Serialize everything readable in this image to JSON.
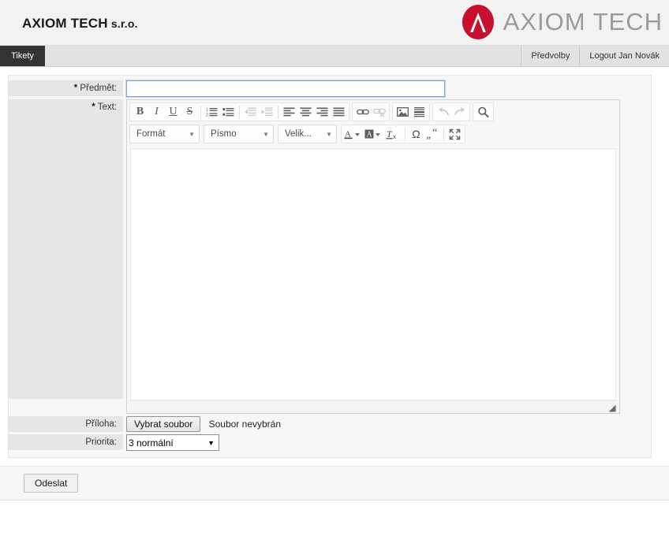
{
  "header": {
    "company_name": "AXIOM TECH",
    "company_suffix": " s.r.o.",
    "brand_text": "AXIOM TECH",
    "logo_color": "#c8102e",
    "logo_icon": "axiom-a-mark"
  },
  "navbar": {
    "tab_label": "Tikety",
    "links": [
      {
        "label": "Předvolby",
        "name": "preferences-link"
      },
      {
        "label": "Logout Jan Novák",
        "name": "logout-link"
      }
    ]
  },
  "form": {
    "subject": {
      "label": "Předmět:",
      "required_mark": "*",
      "value": "",
      "placeholder": ""
    },
    "text": {
      "label": "Text:",
      "required_mark": "*",
      "content": ""
    },
    "attachment": {
      "label": "Příloha:",
      "button_label": "Vybrat soubor",
      "file_status": "Soubor nevybrán"
    },
    "priority": {
      "label": "Priorita:",
      "selected": "3 normální",
      "options": [
        "3 normální"
      ]
    },
    "submit": {
      "label": "Odeslat"
    }
  },
  "editor_toolbar": {
    "row1": [
      {
        "name": "bold-icon",
        "glyph": "B",
        "state": "active"
      },
      {
        "name": "italic-icon",
        "glyph": "I",
        "state": "active"
      },
      {
        "name": "underline-icon",
        "glyph": "U",
        "state": "active"
      },
      {
        "name": "strikethrough-icon",
        "glyph": "S",
        "state": "active"
      },
      {
        "name": "numbered-list-icon",
        "glyph": "",
        "state": "active"
      },
      {
        "name": "bulleted-list-icon",
        "glyph": "",
        "state": "active"
      },
      {
        "name": "outdent-icon",
        "glyph": "",
        "state": "disabled"
      },
      {
        "name": "indent-icon",
        "glyph": "",
        "state": "disabled"
      },
      {
        "name": "align-left-icon",
        "glyph": "",
        "state": "active"
      },
      {
        "name": "align-center-icon",
        "glyph": "",
        "state": "active"
      },
      {
        "name": "align-right-icon",
        "glyph": "",
        "state": "active"
      },
      {
        "name": "align-justify-icon",
        "glyph": "",
        "state": "active"
      },
      {
        "name": "link-icon",
        "glyph": "",
        "state": "active"
      },
      {
        "name": "unlink-icon",
        "glyph": "",
        "state": "disabled"
      },
      {
        "name": "image-icon",
        "glyph": "",
        "state": "active"
      },
      {
        "name": "horizontal-rule-icon",
        "glyph": "",
        "state": "active"
      },
      {
        "name": "undo-icon",
        "glyph": "",
        "state": "disabled"
      },
      {
        "name": "redo-icon",
        "glyph": "",
        "state": "disabled"
      },
      {
        "name": "find-icon",
        "glyph": "",
        "state": "active"
      }
    ],
    "combos": [
      {
        "name": "format-combo",
        "label": "Formát"
      },
      {
        "name": "font-combo",
        "label": "Písmo"
      },
      {
        "name": "fontsize-combo",
        "label": "Velik..."
      }
    ],
    "row2": [
      {
        "name": "text-color-icon",
        "glyph": "A",
        "state": "active"
      },
      {
        "name": "background-color-icon",
        "glyph": "A",
        "state": "active"
      },
      {
        "name": "remove-format-icon",
        "glyph": "Tx",
        "state": "active"
      },
      {
        "name": "special-character-icon",
        "glyph": "Ω",
        "state": "active"
      },
      {
        "name": "blockquote-icon",
        "glyph": "99",
        "state": "active"
      },
      {
        "name": "maximize-icon",
        "glyph": "",
        "state": "active"
      }
    ]
  }
}
